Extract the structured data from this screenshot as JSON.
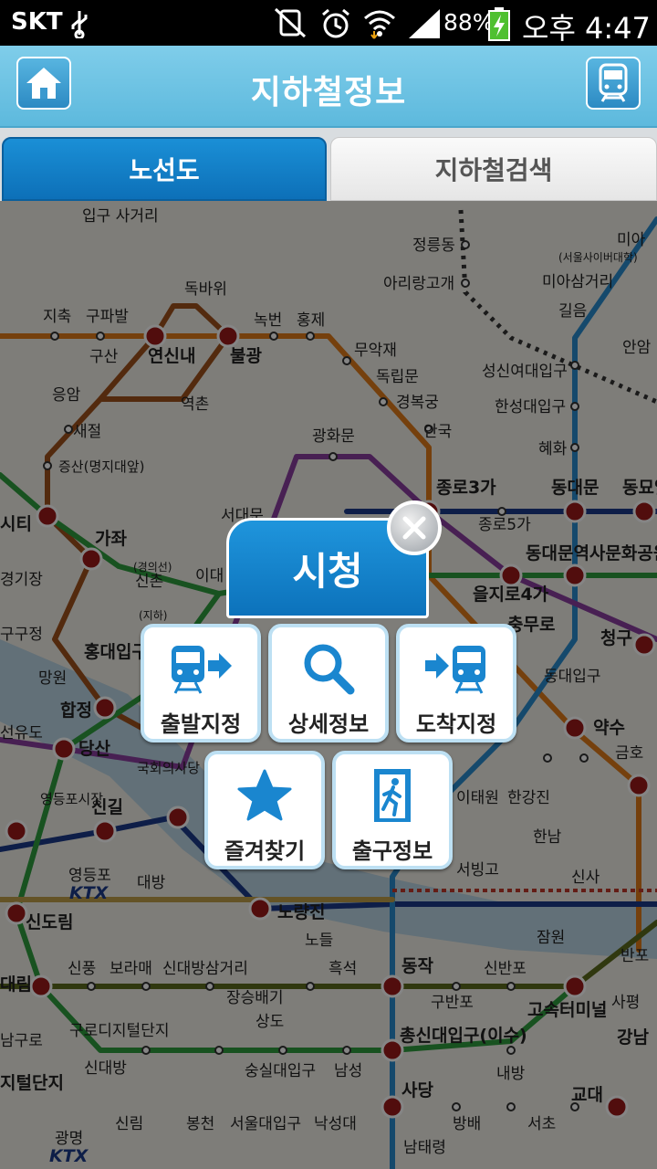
{
  "status_bar": {
    "carrier": "SKT",
    "battery": "88%",
    "time": "오후 4:47",
    "icons": [
      "usb-icon",
      "vibrate-off-icon",
      "alarm-icon",
      "wifi-icon",
      "signal-icon",
      "battery-charging-icon"
    ]
  },
  "header": {
    "title": "지하철정보",
    "home_icon": "home-icon",
    "subway_icon": "subway-train-icon"
  },
  "tabs": [
    {
      "label": "노선도",
      "active": true
    },
    {
      "label": "지하철검색",
      "active": false
    }
  ],
  "map_labels": [
    "입구 사거리",
    "정릉동",
    "아리랑고개",
    "미아",
    "(서울사이버대학)",
    "미아삼거리",
    "길음",
    "안암",
    "독바위",
    "지축",
    "구파발",
    "녹번",
    "홍제",
    "연신내",
    "불광",
    "구산",
    "무악재",
    "독립문",
    "응암",
    "역촌",
    "경복궁",
    "성신여대입구",
    "한성대입구",
    "새절",
    "광화문",
    "안국",
    "혜화",
    "증산(명지대앞)",
    "종로3가",
    "동대문",
    "동묘앞",
    "종로5가",
    "가좌",
    "서대문",
    "동대문역사문화공원",
    "(경의선)",
    "신촌",
    "이대",
    "을지로4가",
    "충무로",
    "청구",
    "(지하)",
    "홍대입구",
    "망원",
    "동대입구",
    "합정",
    "약수",
    "당산",
    "국회의사당",
    "금호",
    "영등포시장",
    "신길",
    "이태원",
    "한강진",
    "영등포",
    "대방",
    "한남",
    "노량진",
    "서빙고",
    "신사",
    "신도림",
    "노들",
    "잠원",
    "반포",
    "신풍",
    "보라매",
    "신대방삼거리",
    "흑석",
    "동작",
    "신반포",
    "고속터미널",
    "구반포",
    "사평",
    "장승배기",
    "상도",
    "구로디지털단지",
    "총신대입구(이수)",
    "강남",
    "신대방",
    "숭실대입구",
    "남성",
    "내방",
    "사당",
    "교대",
    "신림",
    "봉천",
    "서울대입구",
    "낙성대",
    "방배",
    "서초",
    "남태령",
    "광명",
    "지축",
    "시티",
    "경기장",
    "구구정",
    "선유도",
    "대림",
    "남구로",
    "지털단지",
    "KTX"
  ],
  "popup": {
    "station": "시청",
    "close_icon": "close-icon",
    "actions": [
      {
        "label": "출발지정",
        "icon": "departure-train-icon"
      },
      {
        "label": "상세정보",
        "icon": "magnifier-icon"
      },
      {
        "label": "도착지정",
        "icon": "arrival-train-icon"
      },
      {
        "label": "즐겨찾기",
        "icon": "star-icon"
      },
      {
        "label": "출구정보",
        "icon": "exit-icon"
      }
    ]
  },
  "colors": {
    "header": "#5db9dd",
    "tab_active": "#0d70b8",
    "line1": "#1b3b8a",
    "line2": "#2e9e3f",
    "line3": "#e07b1a",
    "line4": "#2a8ccf",
    "line5": "#8a3fa0",
    "line6": "#a0521c",
    "line7": "#5c6b1e",
    "line9": "#c0a04a"
  }
}
